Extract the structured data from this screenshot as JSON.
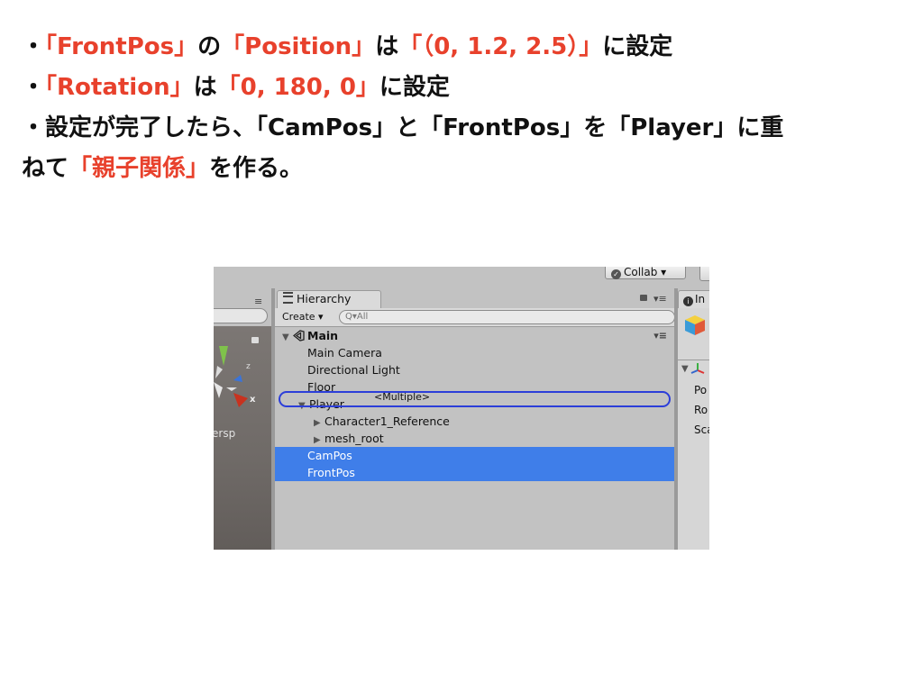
{
  "slide": {
    "line1": {
      "bullet": "・",
      "q1": "「FrontPos」",
      "no": "の",
      "q2": "「Position」",
      "wa": "は",
      "q3": "「（0, 1.2, 2.5）」",
      "tail": "に設定"
    },
    "line2": {
      "bullet": "・",
      "q1": "「Rotation」",
      "wa": "は",
      "q2": "「0, 180, 0」",
      "tail": "に設定"
    },
    "line3": {
      "text": "・設定が完了したら、「CamPos」と「FrontPos」を「Player」に重"
    },
    "line4": {
      "head": "ねて",
      "q1": "「親子関係」",
      "tail": "を作る。"
    }
  },
  "unity": {
    "collab_label": "Collab ▾",
    "scene": {
      "persp_label": "ersp",
      "axis_x": "x",
      "axis_z": "z",
      "menu_icon": "≡"
    },
    "hierarchy": {
      "tab_label": "Hierarchy",
      "create_label": "Create ▾",
      "search_placeholder": "All",
      "search_icon": "Q▾",
      "menu_icon": "▾≡",
      "scene_name": "Main",
      "items": [
        {
          "label": "Main Camera",
          "indent": 1,
          "arrow": ""
        },
        {
          "label": "Directional Light",
          "indent": 1,
          "arrow": ""
        },
        {
          "label": "Floor",
          "indent": 1,
          "arrow": ""
        },
        {
          "label": "Player",
          "indent": 1,
          "arrow": "▼"
        },
        {
          "label": "Character1_Reference",
          "indent": 2,
          "arrow": "▶"
        },
        {
          "label": "mesh_root",
          "indent": 2,
          "arrow": "▶"
        },
        {
          "label": "CamPos",
          "indent": 1,
          "arrow": "",
          "selected": true
        },
        {
          "label": "FrontPos",
          "indent": 1,
          "arrow": "",
          "selected": true
        }
      ],
      "drag_tooltip": "<Multiple>"
    },
    "inspector": {
      "tab_label": "In",
      "field_labels": [
        "Po",
        "Ro",
        "Sca"
      ]
    },
    "colors": {
      "selection": "#3f7ee9",
      "drop_outline": "#2c3ed9",
      "panel_bg": "#c2c2c2",
      "highlight_text": "#e8412c"
    }
  }
}
